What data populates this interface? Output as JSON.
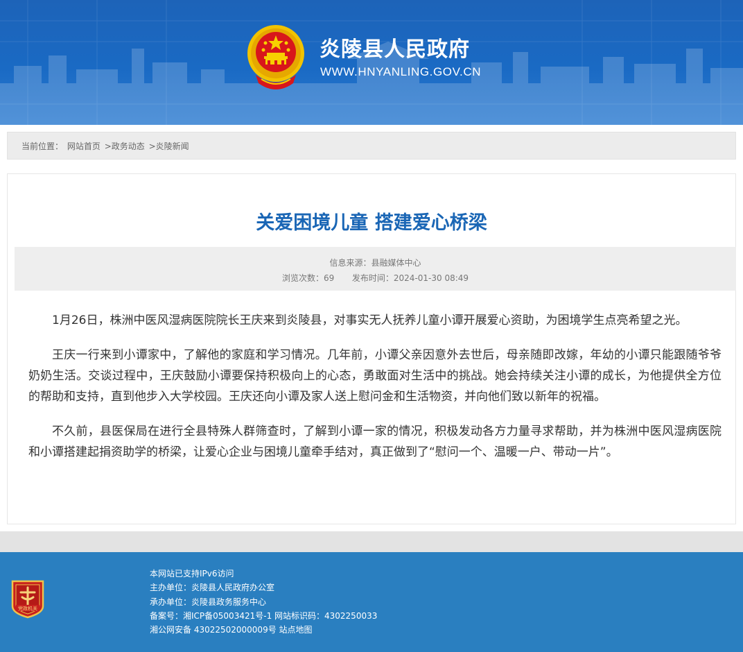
{
  "header": {
    "site_title": "炎陵县人民政府",
    "site_url": "WWW.HNYANLING.GOV.CN",
    "emblem_icon": "national-emblem-icon",
    "brand_color": "#1d63b8"
  },
  "breadcrumb": {
    "prefix": "当前位置：",
    "items": [
      "网站首页",
      ">政务动态",
      ">炎陵新闻"
    ]
  },
  "article": {
    "title": "关爱困境儿童 搭建爱心桥梁",
    "title_color": "#1a66b5",
    "source": "信息来源：县融媒体中心",
    "views_label": "浏览次数：",
    "views": "69",
    "published_label": "发布时间：",
    "published": "2024-01-30 08:49",
    "paragraphs": [
      "1月26日，株洲中医风湿病医院院长王庆来到炎陵县，对事实无人抚养儿童小谭开展爱心资助，为困境学生点亮希望之光。",
      "王庆一行来到小谭家中，了解他的家庭和学习情况。几年前，小谭父亲因意外去世后，母亲随即改嫁，年幼的小谭只能跟随爷爷奶奶生活。交谈过程中，王庆鼓励小谭要保持积极向上的心态，勇敢面对生活中的挑战。她会持续关注小谭的成长，为他提供全方位的帮助和支持，直到他步入大学校园。王庆还向小谭及家人送上慰问金和生活物资，并向他们致以新年的祝福。",
      "不久前，县医保局在进行全县特殊人群筛查时，了解到小谭一家的情况，积极发动各方力量寻求帮助，并为株洲中医风湿病医院和小谭搭建起捐资助学的桥梁，让爱心企业与困境儿童牵手结对，真正做到了“慰问一个、温暖一户、带动一片”。"
    ]
  },
  "footer": {
    "badge_icon": "party-government-badge-icon",
    "badge_text": "党政机关",
    "ipv6": "本网站已支持IPv6访问",
    "host": "主办单位：炎陵县人民政府办公室",
    "organizer": "承办单位：炎陵县政务服务中心",
    "icp": "备案号：湘ICP备05003421号-1 网站标识码：4302250033",
    "police_prefix": "湘公网安备 43022502000009号",
    "sitemap": "站点地图",
    "footer_color": "#2a7fc0"
  }
}
